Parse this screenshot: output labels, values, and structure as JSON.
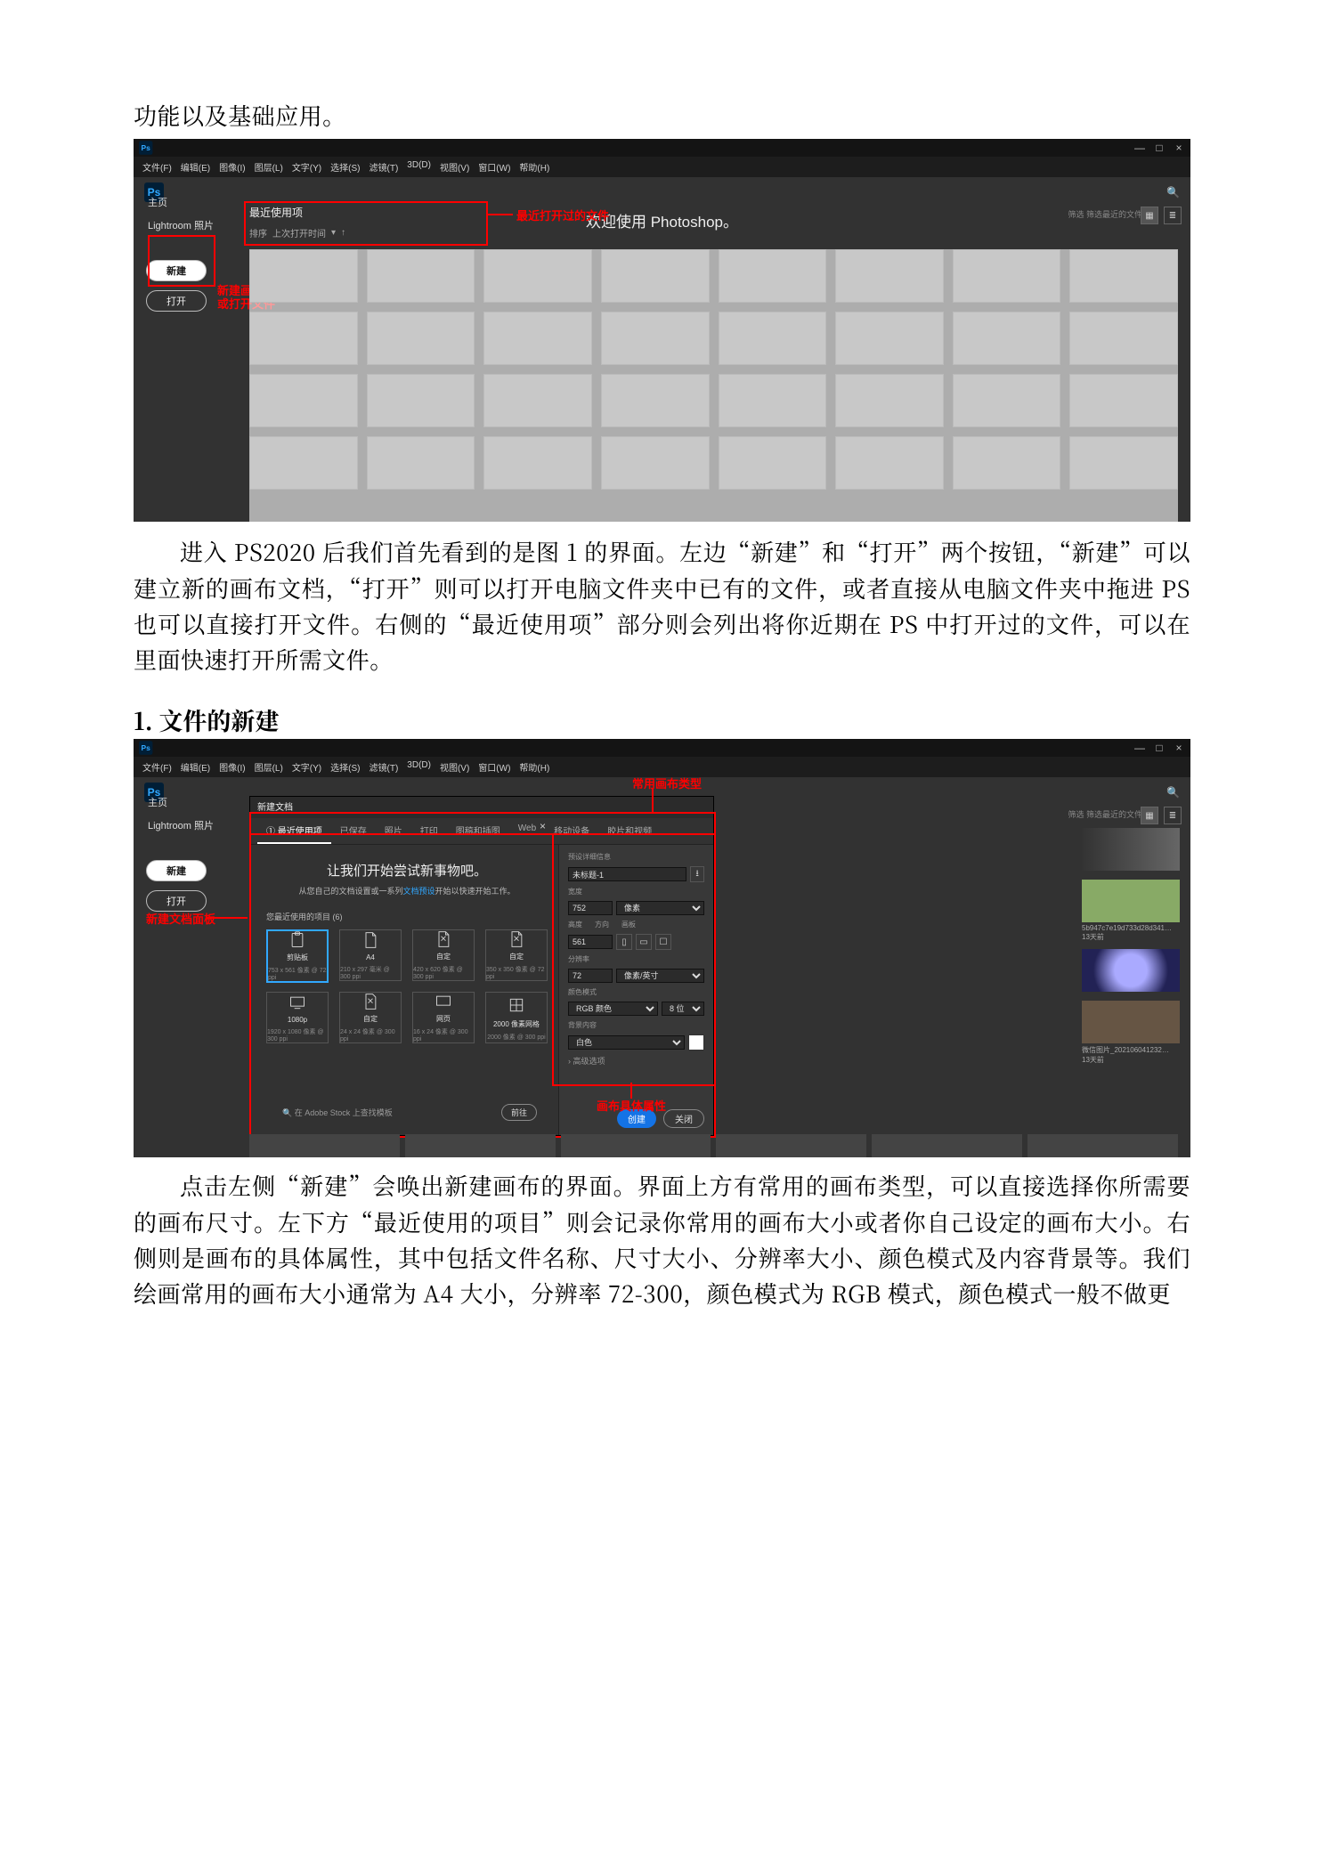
{
  "intro_line": "功能以及基础应用。",
  "figure1": {
    "window_controls": [
      "—",
      "□",
      "×"
    ],
    "menubar": [
      "文件(F)",
      "编辑(E)",
      "图像(I)",
      "图层(L)",
      "文字(Y)",
      "选择(S)",
      "滤镜(T)",
      "3D(D)",
      "视图(V)",
      "窗口(W)",
      "帮助(H)"
    ],
    "logo_text": "Ps",
    "sidebar": {
      "home": "主页",
      "lightroom": "Lightroom 照片"
    },
    "buttons": {
      "new": "新建",
      "open": "打开"
    },
    "welcome": "欢迎使用 Photoshop。",
    "recent_header": "最近使用项",
    "sort_label": "排序",
    "sort_value": "上次打开时间",
    "annotations": {
      "new_open": "新建画板\n或打开文件",
      "recent_files": "最近打开过的文件"
    },
    "right_hint": "筛选  筛选最近的文件"
  },
  "para1": "进入 PS2020 后我们首先看到的是图 1 的界面。左边“新建”和“打开”两个按钮，“新建”可以建立新的画布文档，“打开”则可以打开电脑文件夹中已有的文件，或者直接从电脑文件夹中拖进 PS 也可以直接打开文件。右侧的“最近使用项”部分则会列出将你近期在 PS 中打开过的文件，可以在里面快速打开所需文件。",
  "section1_title": "1. 文件的新建",
  "figure2": {
    "window_controls": [
      "—",
      "□",
      "×"
    ],
    "menubar": [
      "文件(F)",
      "编辑(E)",
      "图像(I)",
      "图层(L)",
      "文字(Y)",
      "选择(S)",
      "滤镜(T)",
      "3D(D)",
      "视图(V)",
      "窗口(W)",
      "帮助(H)"
    ],
    "logo_text": "Ps",
    "sidebar": {
      "home": "主页",
      "lightroom": "Lightroom 照片"
    },
    "buttons": {
      "new": "新建",
      "open": "打开"
    },
    "dialog_title": "新建文档",
    "tabs": [
      "① 最近使用项",
      "已保存",
      "照片",
      "打印",
      "图稿和插图",
      "Web",
      "移动设备",
      "胶片和视频"
    ],
    "headline": "让我们开始尝试新事物吧。",
    "sub_pre": "从您自己的文档设置或一系列",
    "sub_link": "文档预设",
    "sub_post": "开始以快速开始工作。",
    "recent_presets_label": "您最近使用的项目 (6)",
    "presets": [
      {
        "name": "剪贴板",
        "dim": "753 x 561 像素 @ 72 ppi"
      },
      {
        "name": "A4",
        "dim": "210 x 297 毫米 @ 300 ppi"
      },
      {
        "name": "自定",
        "dim": "420 x 620 像素 @ 300 ppi"
      },
      {
        "name": "自定",
        "dim": "350 x 350 像素 @ 72 ppi"
      },
      {
        "name": "1080p",
        "dim": "1920 x 1080 像素 @ 300 ppi"
      },
      {
        "name": "自定",
        "dim": "24 x 24 像素 @ 300 ppi"
      },
      {
        "name": "网页",
        "dim": "16 x 24 像素 @ 300 ppi"
      },
      {
        "name": "2000 像素网格",
        "dim": "2000 像素 @ 300 ppi"
      }
    ],
    "details": {
      "section_label": "预设详细信息",
      "name_value": "未标题-1",
      "width_label": "宽度",
      "width_value": "752",
      "width_unit": "像素",
      "height_label": "高度",
      "orient_label": "方向",
      "artboard_label": "画板",
      "height_value": "561",
      "res_label": "分辨率",
      "res_value": "72",
      "res_unit": "像素/英寸",
      "color_mode_label": "颜色模式",
      "color_mode_value": "RGB 颜色",
      "bit_depth": "8 位",
      "bg_label": "背景内容",
      "bg_value": "白色",
      "advanced": "› 高级选项"
    },
    "search_placeholder": "在 Adobe Stock 上查找模板",
    "go_button": "前往",
    "create_btn": "创建",
    "close_btn": "关闭",
    "right_hint": "筛选  筛选最近的文件",
    "right_thumbs": [
      {
        "label": ""
      },
      {
        "label": "5b947c7e19d733d28d341…\n13天前"
      },
      {
        "label": ""
      },
      {
        "label": "微信图片_202106041232…\n13天前"
      }
    ],
    "annotations": {
      "types": "常用画布类型",
      "panel": "新建文档面板",
      "props": "画布具体属性"
    }
  },
  "para2": "点击左侧“新建”会唤出新建画布的界面。界面上方有常用的画布类型，可以直接选择你所需要的画布尺寸。左下方“最近使用的项目”则会记录你常用的画布大小或者你自己设定的画布大小。右侧则是画布的具体属性，其中包括文件名称、尺寸大小、分辨率大小、颜色模式及内容背景等。我们绘画常用的画布大小通常为 A4 大小，分辨率 72-300，颜色模式为 RGB 模式，颜色模式一般不做更"
}
